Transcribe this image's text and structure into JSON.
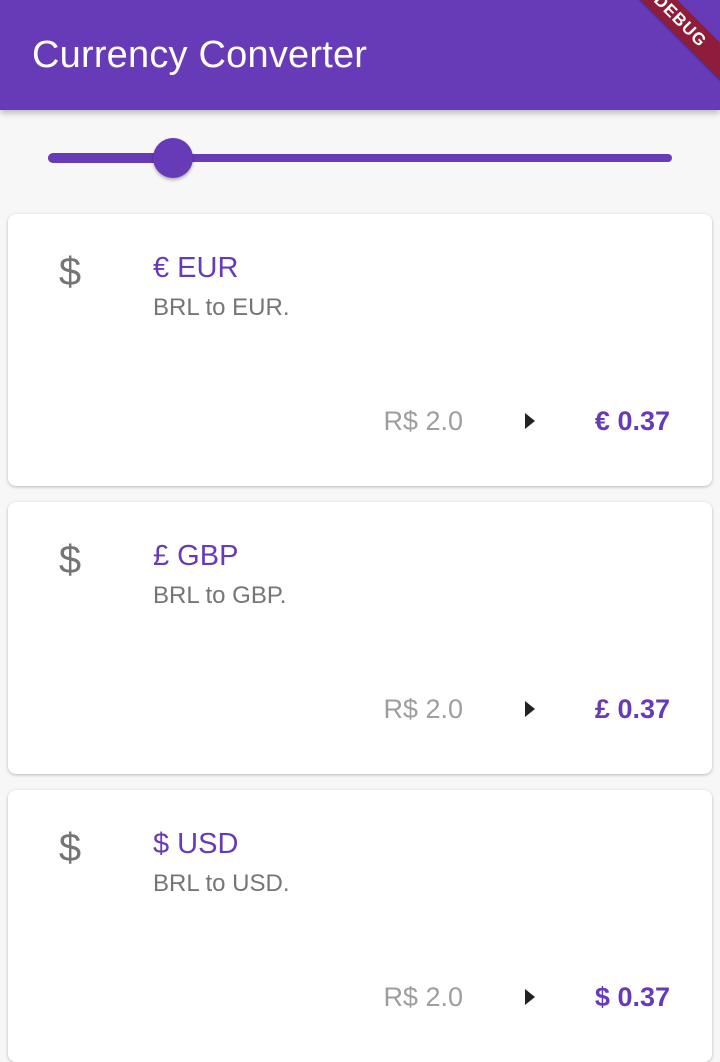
{
  "app_bar": {
    "title": "Currency Converter",
    "debug_banner": "DEBUG",
    "color": "#673ab7"
  },
  "slider": {
    "fraction": 0.2
  },
  "cards": [
    {
      "icon": "$",
      "title": "€ EUR",
      "subtitle": "BRL to EUR.",
      "amount": "R$ 2.0",
      "result": "€ 0.37"
    },
    {
      "icon": "$",
      "title": "£ GBP",
      "subtitle": "BRL to GBP.",
      "amount": "R$ 2.0",
      "result": "£ 0.37"
    },
    {
      "icon": "$",
      "title": "$ USD",
      "subtitle": "BRL to USD.",
      "amount": "R$ 2.0",
      "result": "$ 0.37"
    }
  ]
}
